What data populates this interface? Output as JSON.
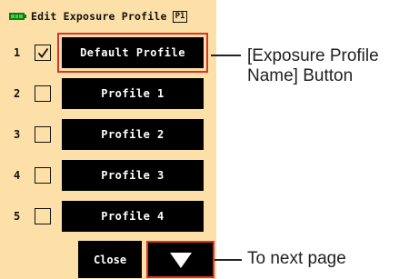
{
  "header": {
    "battery_icon": "battery-icon",
    "title": "Edit Exposure Profile",
    "page_badge": "P1"
  },
  "profiles": [
    {
      "number": "1",
      "checked": true,
      "label": "Default Profile",
      "selected": true
    },
    {
      "number": "2",
      "checked": false,
      "label": "Profile 1",
      "selected": false
    },
    {
      "number": "3",
      "checked": false,
      "label": "Profile 2",
      "selected": false
    },
    {
      "number": "4",
      "checked": false,
      "label": "Profile 3",
      "selected": false
    },
    {
      "number": "5",
      "checked": false,
      "label": "Profile 4",
      "selected": false
    }
  ],
  "footer": {
    "close_label": "Close",
    "next_icon": "triangle-down-icon"
  },
  "callouts": {
    "profile_name_line1": "[Exposure Profile",
    "profile_name_line2": "Name] Button",
    "next_page": "To next page"
  },
  "colors": {
    "screen_bg": "#fde0a8",
    "button_bg": "#000000",
    "highlight": "#d9342b",
    "battery": "#39d53c"
  }
}
